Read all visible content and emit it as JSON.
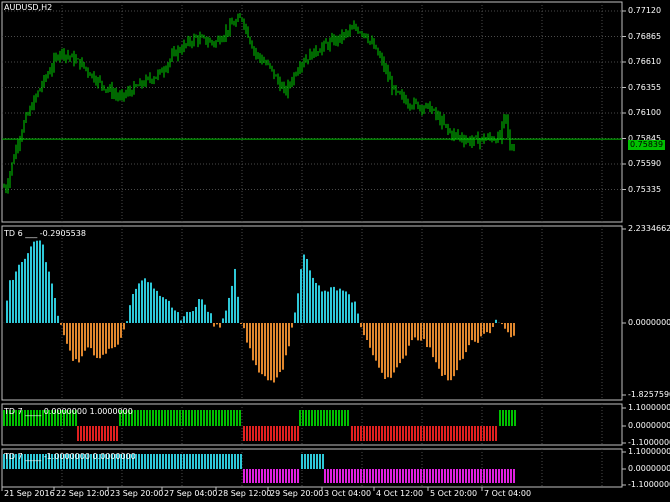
{
  "main": {
    "title": "AUDUSD,H2",
    "y_ticks": [
      "0.77120",
      "0.76865",
      "0.76610",
      "0.76355",
      "0.76100",
      "0.75845",
      "0.75590",
      "0.75335"
    ],
    "current_price": "0.75839",
    "current_line_color": "#00c000"
  },
  "td6": {
    "title": "TD 6",
    "value": "-0.2905538",
    "y_ticks": [
      "2.2334662",
      "0.0000000",
      "-1.8257590"
    ],
    "pos_color": "#2ec8d8",
    "neg_color": "#e0872e"
  },
  "td7a": {
    "title": "TD 7",
    "values": "0.0000000  1.0000000",
    "y_ticks": [
      "1.1000000",
      "0.0000000",
      "-1.1000000"
    ],
    "up_color": "#00c000",
    "down_color": "#e02020"
  },
  "td7b": {
    "title": "TD 7",
    "values": "-1.0000000  0.0000000",
    "y_ticks": [
      "1.1000000",
      "0.0000000",
      "-1.1000000"
    ],
    "up_color": "#2ec8d8",
    "down_color": "#e020e0"
  },
  "x_axis": [
    "21 Sep 2016",
    "22 Sep 12:00",
    "23 Sep 20:00",
    "27 Sep 04:00",
    "28 Sep 12:00",
    "29 Sep 20:00",
    "3 Oct 04:00",
    "4 Oct 12:00",
    "5 Oct 20:00",
    "7 Oct 04:00"
  ],
  "colors": {
    "grid": "#4a4a4a",
    "frame": "#c0c0c0",
    "candle": "#00d000"
  }
}
